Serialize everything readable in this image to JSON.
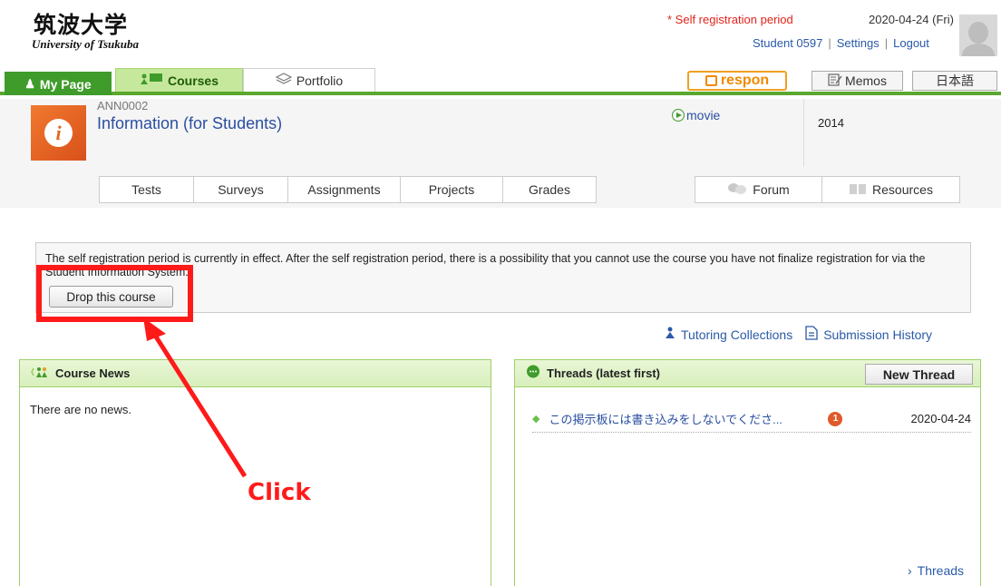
{
  "header": {
    "logo_jp": "筑波大学",
    "logo_en": "University of Tsukuba",
    "registration_notice": "* Self registration period",
    "date": "2020-04-24 (Fri)",
    "user": "Student 0597",
    "settings": "Settings",
    "logout": "Logout",
    "sep": "|"
  },
  "nav": {
    "my_page": "My Page",
    "courses": "Courses",
    "portfolio": "Portfolio",
    "respon": "respon",
    "memos": "Memos",
    "language": "日本語"
  },
  "course": {
    "code": "ANN0002",
    "title": "Information (for Students)",
    "movie": "movie",
    "year": "2014",
    "tabs_left": [
      "Tests",
      "Surveys",
      "Assignments",
      "Projects",
      "Grades"
    ],
    "tabs_right": [
      "Forum",
      "Resources"
    ]
  },
  "notice": {
    "text": "The self registration period is currently in effect. After the self registration period, there is a possibility that you cannot use the course you have not finalize registration for via the Student Information System.",
    "drop_button": "Drop this course"
  },
  "links": {
    "tutoring": "Tutoring Collections",
    "submission": "Submission History"
  },
  "news": {
    "title": "Course News",
    "empty": "There are no news."
  },
  "threads": {
    "title": "Threads (latest first)",
    "new_thread": "New Thread",
    "items": [
      {
        "title": "この掲示板には書き込みをしないでくださ...",
        "badge": "1",
        "date": "2020-04-24"
      }
    ],
    "more": "Threads"
  },
  "annotation": {
    "label": "Click",
    "color": "#ff1a1a"
  },
  "colors": {
    "accent_green": "#3f9c2a",
    "link_blue": "#2a4fa0",
    "alert_red": "#e2231a",
    "respon_orange": "#f08a00"
  }
}
